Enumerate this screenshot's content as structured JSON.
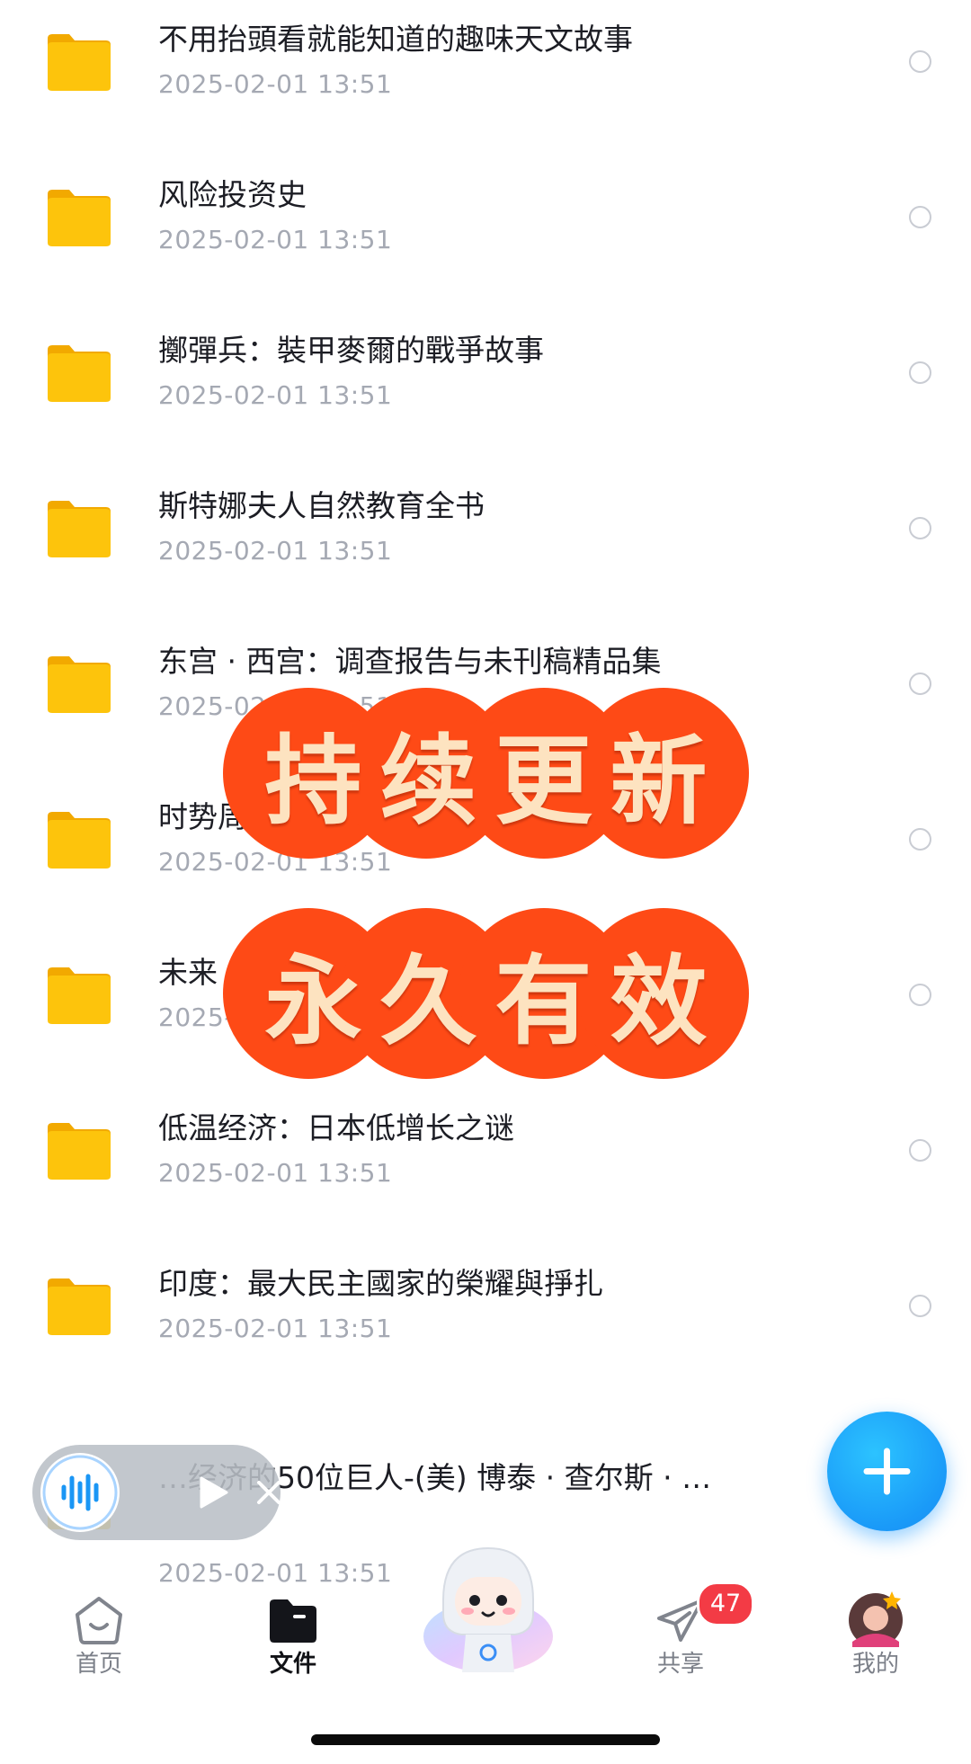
{
  "files": [
    {
      "title": "不用抬頭看就能知道的趣味天文故事",
      "date": "2025-02-01 13:51"
    },
    {
      "title": "风险投资史",
      "date": "2025-02-01 13:51"
    },
    {
      "title": "擲彈兵：裝甲麥爾的戰爭故事",
      "date": "2025-02-01 13:51"
    },
    {
      "title": "斯特娜夫人自然教育全书",
      "date": "2025-02-01 13:51"
    },
    {
      "title": "东宫 · 西宫：调查报告与未刊稿精品集",
      "date": "2025-02-01 13:51"
    },
    {
      "title": "时势周期波动下的国家、社会和个人",
      "date": "2025-02-01 13:51"
    },
    {
      "title": "未来",
      "date": "2025-02-01 13:51"
    },
    {
      "title": "低温经济：日本低增长之谜",
      "date": "2025-02-01 13:51"
    },
    {
      "title": "印度：最大民主國家的榮耀與掙扎",
      "date": "2025-02-01 13:51"
    },
    {
      "title": "…经济的50位巨人-(美) 博泰 · 查尔斯 · …",
      "date": "2025-02-01 13:51"
    }
  ],
  "promo": {
    "line1": "持续更新",
    "line2": "永久有效",
    "color": "#fe4a16",
    "text_color": "#fde3c0"
  },
  "fab": {
    "icon": "plus-icon",
    "color": "#1a9af8"
  },
  "audio_widget": {
    "icons": [
      "waveform-icon",
      "play-icon",
      "close-icon"
    ]
  },
  "nav": {
    "home": "首页",
    "files": "文件",
    "share": "共享",
    "share_badge": "47",
    "me": "我的",
    "active": "files"
  },
  "colors": {
    "folder": "#fdc40c",
    "badge": "#f33b45"
  }
}
